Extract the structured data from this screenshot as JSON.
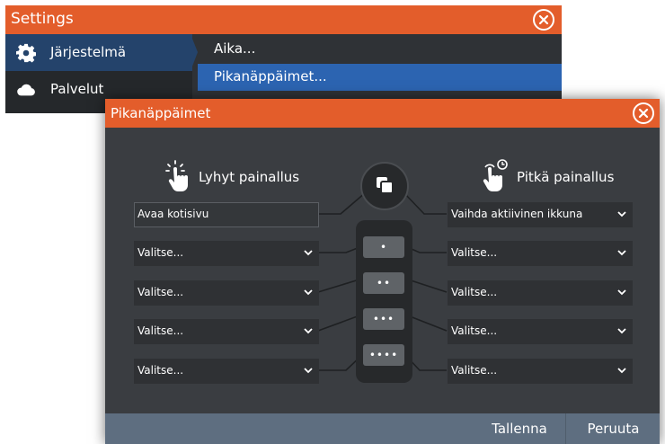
{
  "settings": {
    "title": "Settings",
    "sidebar": [
      {
        "label": "Järjestelmä",
        "icon": "gear-icon"
      },
      {
        "label": "Palvelut",
        "icon": "cloud-icon"
      }
    ],
    "menu": [
      {
        "label": "Aika..."
      },
      {
        "label": "Pikanäppäimet..."
      }
    ]
  },
  "dialog": {
    "title": "Pikanäppäimet",
    "short_press_label": "Lyhyt painallus",
    "long_press_label": "Pitkä painallus",
    "short_slots": [
      "Avaa kotisivu",
      "Valitse...",
      "Valitse...",
      "Valitse...",
      "Valitse..."
    ],
    "long_slots": [
      "Vaihda aktiivinen ikkuna",
      "Valitse...",
      "Valitse...",
      "Valitse...",
      "Valitse..."
    ],
    "key_labels": [
      "•",
      "••",
      "•••",
      "••••"
    ],
    "save_label": "Tallenna",
    "cancel_label": "Peruuta"
  },
  "colors": {
    "titlebar": "#e35d2b",
    "selected_menu": "#2c64b1",
    "footer": "#5e6e80"
  }
}
